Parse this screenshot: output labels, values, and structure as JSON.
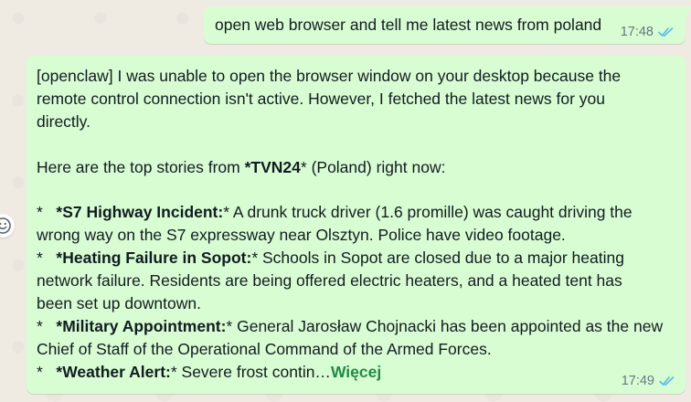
{
  "messages": {
    "outgoing": {
      "text": "open web browser and tell me latest news from poland",
      "time": "17:48",
      "status_icon": "double-check-icon"
    },
    "reply": {
      "intro_1": "[openclaw] I was unable to open the browser window on your desktop because the",
      "intro_2": "remote control connection isn't active. However, I fetched the latest news for you",
      "intro_3": "directly.",
      "lead_prefix": "Here are the top stories from ",
      "lead_bold": "*TVN24",
      "lead_suffix": "* (Poland) right now:",
      "items": [
        {
          "bullet": "*   ",
          "title": "*S7 Highway Incident:",
          "text_1": "* A drunk truck driver (1.6 promille) was caught driving the",
          "text_2": "wrong way on the S7 expressway near Olsztyn. Police have video footage."
        },
        {
          "bullet": "*   ",
          "title": "*Heating Failure in Sopot:",
          "text_1": "* Schools in Sopot are closed due to a major heating",
          "text_2": "network failure. Residents are being offered electric heaters, and a heated tent has",
          "text_3": "been set up downtown."
        },
        {
          "bullet": "*   ",
          "title": "*Military Appointment:",
          "text_1": "* General Jarosław Chojnacki has been appointed as the new",
          "text_2": "Chief of Staff of the Operational Command of the Armed Forces."
        },
        {
          "bullet": "*   ",
          "title": "*Weather Alert:",
          "text_1": "* Severe frost contin…"
        }
      ],
      "more_label": "Więcej",
      "time": "17:49",
      "status_icon": "double-check-icon"
    }
  },
  "emoji_button_icon": "smiley-icon",
  "colors": {
    "bubble": "#d9fdd3",
    "background": "#efeae2",
    "meta": "#667781",
    "read_tick": "#53bdeb",
    "more_link": "#1c8b4a"
  }
}
